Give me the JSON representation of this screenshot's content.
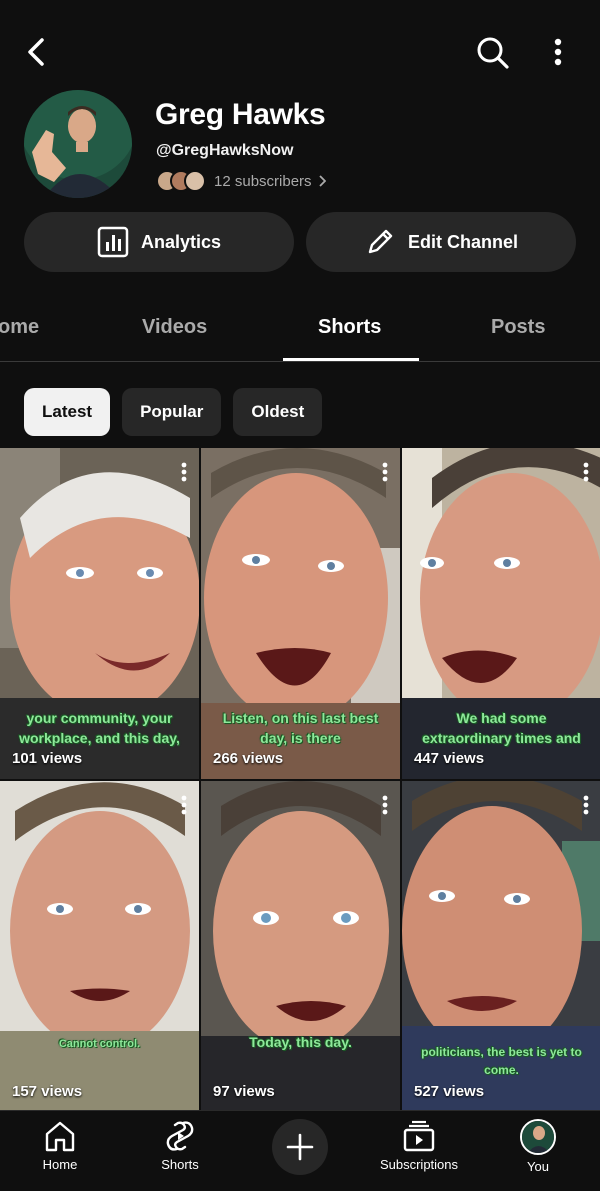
{
  "header": {
    "back_icon": "back-arrow-icon",
    "search_icon": "search-icon",
    "more_icon": "more-vertical-icon"
  },
  "channel": {
    "name": "Greg Hawks",
    "handle": "@GregHawksNow",
    "subscribers": "12 subscribers"
  },
  "actions": {
    "analytics": "Analytics",
    "edit": "Edit Channel"
  },
  "tabs": [
    {
      "label": "ome"
    },
    {
      "label": "Videos"
    },
    {
      "label": "Shorts"
    },
    {
      "label": "Posts"
    }
  ],
  "chips": [
    {
      "label": "Latest"
    },
    {
      "label": "Popular"
    },
    {
      "label": "Oldest"
    }
  ],
  "shorts": [
    {
      "caption": "your community, your workplace, and this day,",
      "views": "101 views"
    },
    {
      "caption": "Listen, on this last best day, is there",
      "views": "266 views"
    },
    {
      "caption": "We had some extraordinary times and",
      "views": "447 views"
    },
    {
      "caption": "Cannot control.",
      "views": "157 views"
    },
    {
      "caption": "Today, this day.",
      "views": "97 views"
    },
    {
      "caption": "politicians, the best is yet to come.",
      "views": "527 views"
    }
  ],
  "bottom_nav": {
    "home": "Home",
    "shorts": "Shorts",
    "subscriptions": "Subscriptions",
    "you": "You"
  },
  "colors": {
    "background": "#0f0f0f",
    "surface": "#272727",
    "caption": "#8ee89a"
  }
}
